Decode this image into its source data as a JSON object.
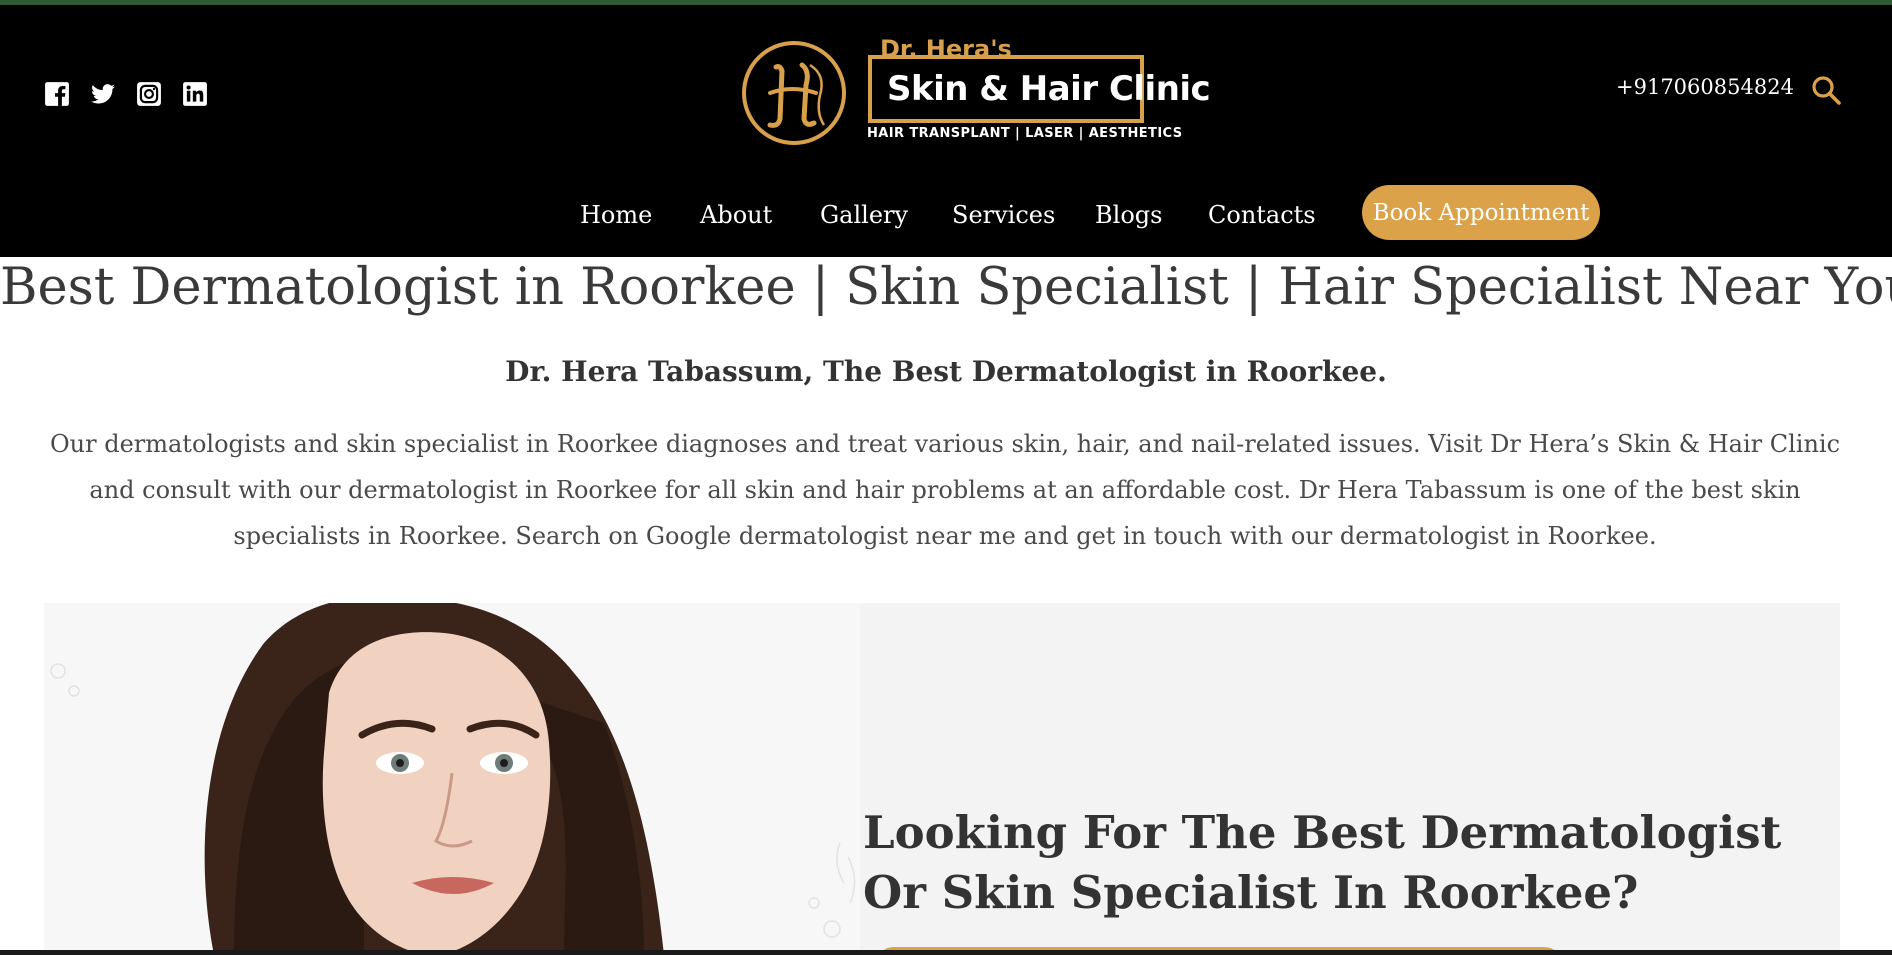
{
  "header": {
    "social_icons": [
      "facebook-icon",
      "twitter-icon",
      "instagram-icon",
      "linkedin-icon"
    ],
    "logo": {
      "doctor_name": "Dr. Hera's",
      "clinic_name": "Skin & Hair Clinic",
      "tagline": "HAIR TRANSPLANT | LASER | AESTHETICS",
      "monogram": "H"
    },
    "phone": "+917060854824",
    "search_icon": "search-icon"
  },
  "nav": {
    "items": [
      {
        "label": "Home"
      },
      {
        "label": "About"
      },
      {
        "label": "Gallery"
      },
      {
        "label": "Services"
      },
      {
        "label": "Blogs"
      },
      {
        "label": "Contacts"
      }
    ],
    "cta_label": "Book Appointment"
  },
  "content": {
    "title": "Best Dermatologist in Roorkee | Skin Specialist | Hair Specialist Near You",
    "subtitle": "Dr. Hera Tabassum, The Best Dermatologist in Roorkee.",
    "intro": "Our dermatologists and skin specialist in Roorkee diagnoses and treat various skin, hair, and nail-related issues. Visit Dr Hera’s Skin & Hair Clinic and consult with our dermatologist in Roorkee for all skin and hair problems at an affordable cost. Dr Hera Tabassum is one of the best skin specialists in Roorkee. Search on Google dermatologist near me and get in touch with our dermatologist in Roorkee."
  },
  "hero": {
    "heading": "Looking For The Best Dermatologist Or Skin Specialist In Roorkee?"
  },
  "colors": {
    "accent": "#dca249",
    "header_bg": "#000000",
    "top_strip": "#2e5a35",
    "text_dark": "#3a3a3a"
  }
}
